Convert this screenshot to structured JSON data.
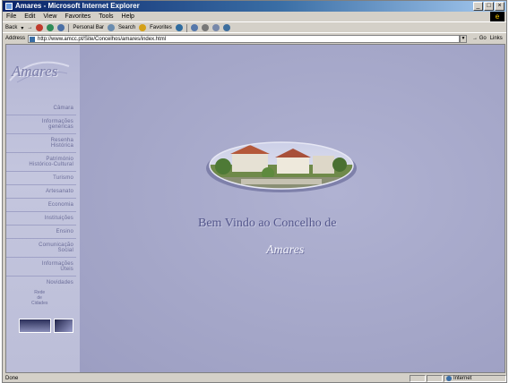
{
  "window": {
    "title": "Amares - Microsoft Internet Explorer",
    "controls": [
      "_",
      "□",
      "×"
    ]
  },
  "menu": [
    "File",
    "Edit",
    "View",
    "Favorites",
    "Tools",
    "Help"
  ],
  "toolbar": {
    "back": "Back",
    "personal_bar": "Personal Bar",
    "search": "Search",
    "favorites": "Favorites"
  },
  "address": {
    "label": "Address",
    "url": "http://www.amcc.pt/Site/Concelhos/amares/index.html",
    "go": "Go",
    "links": "Links"
  },
  "site": {
    "logo": "Amares",
    "nav": [
      "Câmara",
      "Informações\ngenéricas",
      "Resenha\nHistórica",
      "Património\nHistórico-Cultural",
      "Turismo",
      "Artesanato",
      "Economia",
      "Instituições",
      "Ensino",
      "Comunicação\nSocial",
      "Informações\nÚteis",
      "Novidades"
    ],
    "sub_note": "Rede\nde\nCidades",
    "welcome": "Bem Vindo ao Concelho de",
    "welcome_name": "Amares"
  },
  "status": {
    "left": "Done",
    "zone": "Internet"
  },
  "colors": {
    "titlebar": "#0a246a",
    "content_bg": "#a8a9cc",
    "nav_text": "#6a6c98",
    "welcome_text": "#54578c"
  }
}
